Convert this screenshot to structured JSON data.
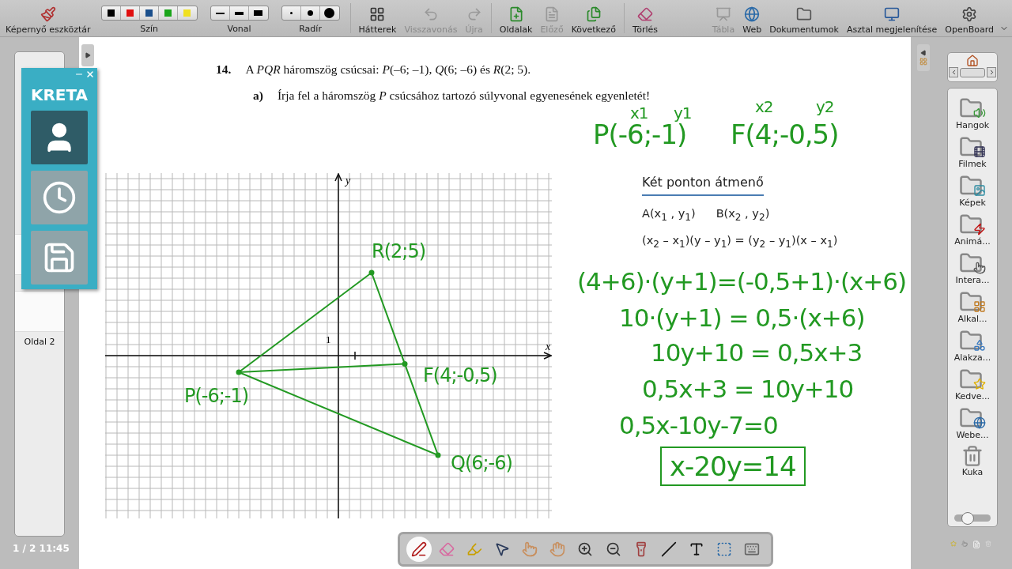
{
  "toolbar": {
    "left": [
      {
        "kind": "screen_tools",
        "label": "Képernyő eszköztár",
        "disabled": false
      },
      {
        "kind": "colors",
        "label": "Szín",
        "swatches": [
          {
            "color": "#000000"
          },
          {
            "color": "#e01010"
          },
          {
            "color": "#1a4f8c"
          },
          {
            "color": "#1aa51a"
          },
          {
            "color": "#f0e020"
          }
        ]
      },
      {
        "kind": "widths",
        "label": "Vonal",
        "options": [
          {
            "kind": "small"
          },
          {
            "kind": "medium"
          },
          {
            "kind": "large"
          }
        ]
      },
      {
        "kind": "dots",
        "label": "Radír",
        "options": [
          {
            "kind": "small"
          },
          {
            "kind": "medium"
          },
          {
            "kind": "large"
          }
        ]
      },
      {
        "kind": "backgrounds",
        "label": "Hátterek",
        "disabled": false
      },
      {
        "kind": "undo",
        "label": "Visszavonás",
        "disabled": true
      },
      {
        "kind": "redo",
        "label": "Újra",
        "disabled": true
      },
      {
        "kind": "pages",
        "label": "Oldalak",
        "disabled": false
      },
      {
        "kind": "previous",
        "label": "Előző",
        "disabled": true
      },
      {
        "kind": "next",
        "label": "Következő",
        "disabled": false
      },
      {
        "kind": "clear",
        "label": "Törlés",
        "disabled": false
      }
    ],
    "right": [
      {
        "kind": "board",
        "label": "Tábla",
        "disabled": true
      },
      {
        "kind": "web",
        "label": "Web",
        "disabled": false
      },
      {
        "kind": "documents",
        "label": "Dokumentumok",
        "disabled": false
      },
      {
        "kind": "desktop",
        "label": "Asztal megjelenítése",
        "disabled": false
      },
      {
        "kind": "app",
        "label": "OpenBoard",
        "disabled": false
      }
    ]
  },
  "pages_panel": {
    "thumbnails": [
      {
        "label": "Oldal 2"
      }
    ],
    "footer": "1 / 2 11:45"
  },
  "kreta": {
    "logo": "KRETA",
    "buttons": [
      {
        "kind": "person",
        "selected": true
      },
      {
        "kind": "clock",
        "selected": false
      },
      {
        "kind": "save",
        "selected": false
      }
    ]
  },
  "problem": {
    "number": "14.",
    "text": "A *PQR* háromszög csúcsai: *P*(–6; –1), *Q*(6; –6) és *R*(2; 5).",
    "part": "a)",
    "question": "Írja fel a háromszög *P* csúcsához tartozó súlyvonal egyenesének egyenletét!"
  },
  "header_ink": {
    "subscripts": [
      "x1",
      "y1",
      "x2",
      "y2"
    ],
    "points": [
      "P(-6;-1)",
      "F(4;-0,5)"
    ]
  },
  "graph": {
    "axis_x": "x",
    "axis_y": "y",
    "tick_label": "1",
    "points": [
      {
        "label": "P(-6;-1)"
      },
      {
        "label": "R(2;5)"
      },
      {
        "label": "Q(6;-6)"
      },
      {
        "label": "F(4;-0,5)"
      }
    ]
  },
  "formula": {
    "title": "Két ponton átmenő",
    "points": [
      "A(x$_{1}$ , y$_{1}$)",
      "B(x$_{2}$ , y$_{2}$)"
    ],
    "equation": "(x$_{2}$ – x$_{1}$)(y – y$_{1}$) = (y$_{2}$ – y$_{1}$)(x – x$_{1}$)"
  },
  "solution": [
    {
      "kind": "line",
      "text": "(4+6)·(y+1)=(-0,5+1)·(x+6)"
    },
    {
      "kind": "line",
      "text": "10·(y+1) = 0,5·(x+6)"
    },
    {
      "kind": "line",
      "text": "10y+10 = 0,5x+3"
    },
    {
      "kind": "line",
      "text": "0,5x+3 = 10y+10"
    },
    {
      "kind": "line",
      "text": "0,5x-10y-7=0"
    },
    {
      "kind": "boxed",
      "text": "x-20y=14"
    }
  ],
  "library": {
    "items": [
      {
        "kind": "folder",
        "label": "Hangok"
      },
      {
        "kind": "folder",
        "label": "Filmek"
      },
      {
        "kind": "folder",
        "label": "Képek"
      },
      {
        "kind": "folder",
        "label": "Animá..."
      },
      {
        "kind": "folder",
        "label": "Intera..."
      },
      {
        "kind": "folder",
        "label": "Alkal..."
      },
      {
        "kind": "folder",
        "label": "Alakza..."
      },
      {
        "kind": "folder",
        "label": "Kedve..."
      },
      {
        "kind": "folder",
        "label": "Webe..."
      },
      {
        "kind": "trash",
        "label": "Kuka"
      }
    ],
    "zoom": {
      "level": 0.35
    }
  },
  "tools": [
    {
      "kind": "pen",
      "selected": true
    },
    {
      "kind": "eraser",
      "selected": false
    },
    {
      "kind": "marker",
      "selected": false
    },
    {
      "kind": "selector",
      "selected": false
    },
    {
      "kind": "interact",
      "selected": false
    },
    {
      "kind": "hand",
      "selected": false
    },
    {
      "kind": "zoom_in",
      "selected": false
    },
    {
      "kind": "zoom_out",
      "selected": false
    },
    {
      "kind": "laser",
      "selected": false
    },
    {
      "kind": "line",
      "selected": false
    },
    {
      "kind": "text",
      "selected": false
    },
    {
      "kind": "capture",
      "selected": false
    },
    {
      "kind": "keyboard",
      "selected": false
    }
  ]
}
